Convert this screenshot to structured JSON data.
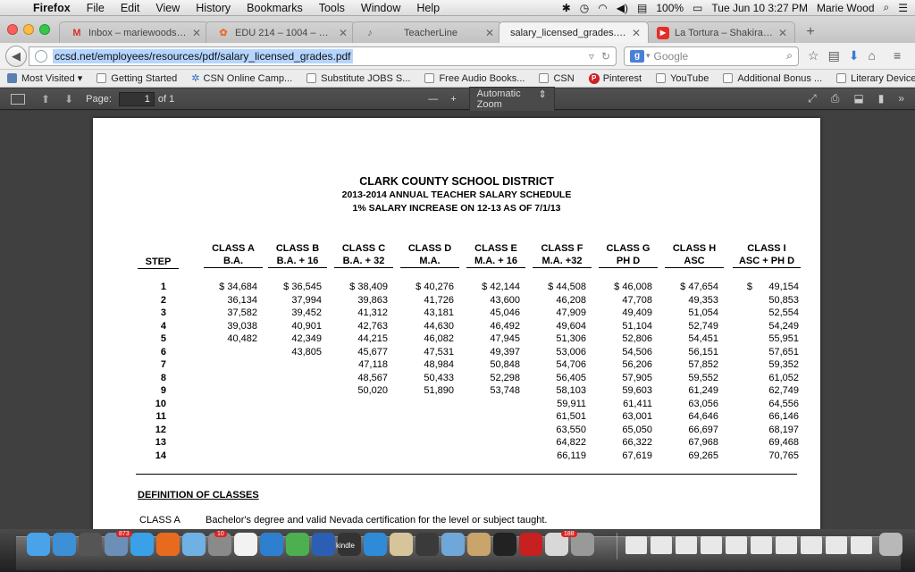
{
  "menubar": {
    "app": "Firefox",
    "items": [
      "File",
      "Edit",
      "View",
      "History",
      "Bookmarks",
      "Tools",
      "Window",
      "Help"
    ],
    "battery": "100%",
    "datetime": "Tue Jun 10  3:27 PM",
    "user": "Marie Wood"
  },
  "tabs": [
    {
      "title": "Inbox – mariewoodsoc@g...",
      "favicon_color": "#d93025",
      "glyph": "M"
    },
    {
      "title": "EDU 214 – 1004 – 1005 S...",
      "favicon_color": "#e8702a",
      "glyph": "✿"
    },
    {
      "title": "TeacherLine",
      "favicon_color": "#666666",
      "glyph": "♪"
    },
    {
      "title": "salary_licensed_grades.pdf",
      "favicon_color": "#ffffff",
      "glyph": ""
    },
    {
      "title": "La Tortura – Shakira [Lyric...",
      "favicon_color": "#e52d27",
      "glyph": "▶"
    }
  ],
  "nav": {
    "url": "ccsd.net/employees/resources/pdf/salary_licensed_grades.pdf",
    "search_placeholder": "Google"
  },
  "bookmarks": [
    "Most Visited",
    "Getting Started",
    "CSN Online Camp...",
    "Substitute JOBS S...",
    "Free Audio Books...",
    "CSN",
    "Pinterest",
    "YouTube",
    "Additional Bonus ...",
    "Literary Devices |..."
  ],
  "pdf_toolbar": {
    "page_label": "Page:",
    "page_value": "1",
    "page_of": "of 1",
    "zoom_minus": "—",
    "zoom_plus": "+",
    "zoom": "Automatic Zoom"
  },
  "document": {
    "title": "CLARK COUNTY SCHOOL DISTRICT",
    "subtitle1": "2013-2014 ANNUAL TEACHER SALARY SCHEDULE",
    "subtitle2": "1% SALARY INCREASE ON 12-13 AS OF 7/1/13",
    "step_header": "STEP",
    "steps": [
      "1",
      "2",
      "3",
      "4",
      "5",
      "6",
      "7",
      "8",
      "9",
      "10",
      "11",
      "12",
      "13",
      "14"
    ],
    "columns": [
      {
        "top": "CLASS A",
        "bottom": "B.A.",
        "values": [
          "$ 34,684",
          "36,134",
          "37,582",
          "39,038",
          "40,482"
        ]
      },
      {
        "top": "CLASS B",
        "bottom": "B.A. + 16",
        "values": [
          "$ 36,545",
          "37,994",
          "39,452",
          "40,901",
          "42,349",
          "43,805"
        ]
      },
      {
        "top": "CLASS C",
        "bottom": "B.A. + 32",
        "values": [
          "$ 38,409",
          "39,863",
          "41,312",
          "42,763",
          "44,215",
          "45,677",
          "47,118",
          "48,567",
          "50,020"
        ]
      },
      {
        "top": "CLASS D",
        "bottom": "M.A.",
        "values": [
          "$ 40,276",
          "41,726",
          "43,181",
          "44,630",
          "46,082",
          "47,531",
          "48,984",
          "50,433",
          "51,890"
        ]
      },
      {
        "top": "CLASS E",
        "bottom": "M.A. + 16",
        "values": [
          "$ 42,144",
          "43,600",
          "45,046",
          "46,492",
          "47,945",
          "49,397",
          "50,848",
          "52,298",
          "53,748"
        ]
      },
      {
        "top": "CLASS F",
        "bottom": "M.A. +32",
        "values": [
          "$ 44,508",
          "46,208",
          "47,909",
          "49,604",
          "51,306",
          "53,006",
          "54,706",
          "56,405",
          "58,103",
          "59,911",
          "61,501",
          "63,550",
          "64,822",
          "66,119"
        ]
      },
      {
        "top": "CLASS G",
        "bottom": "PH D",
        "values": [
          "$ 46,008",
          "47,708",
          "49,409",
          "51,104",
          "52,806",
          "54,506",
          "56,206",
          "57,905",
          "59,603",
          "61,411",
          "63,001",
          "65,050",
          "66,322",
          "67,619"
        ]
      },
      {
        "top": "CLASS H",
        "bottom": "ASC",
        "values": [
          "$ 47,654",
          "49,353",
          "51,054",
          "52,749",
          "54,451",
          "56,151",
          "57,852",
          "59,552",
          "61,249",
          "63,056",
          "64,646",
          "66,697",
          "67,968",
          "69,265"
        ]
      },
      {
        "top": "CLASS I",
        "bottom": "ASC + PH D",
        "values": [
          "$      49,154",
          "50,853",
          "52,554",
          "54,249",
          "55,951",
          "57,651",
          "59,352",
          "61,052",
          "62,749",
          "64,556",
          "66,146",
          "68,197",
          "69,468",
          "70,765"
        ]
      }
    ],
    "definitions_heading": "DEFINITION OF CLASSES",
    "definition": {
      "label": "CLASS A",
      "text": "Bachelor's degree and valid Nevada certification for the level or subject taught."
    }
  },
  "dock": {
    "badges": [
      "873",
      "10",
      "188"
    ],
    "kindle_label": "kindle"
  }
}
